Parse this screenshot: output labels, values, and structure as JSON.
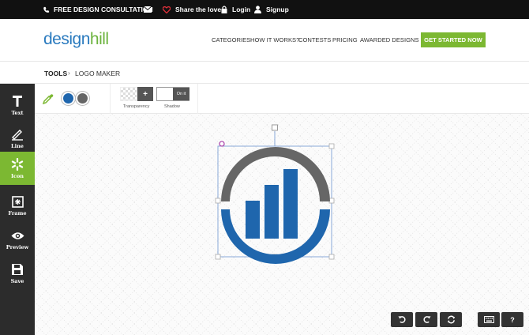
{
  "topbar": {
    "consultation": "FREE DESIGN CONSULTATION",
    "share": "Share the love",
    "login": "Login",
    "signup": "Signup"
  },
  "header": {
    "logo_part1": "design",
    "logo_part2": "hill",
    "nav": [
      "CATEGORIES",
      "HOW IT WORKS?",
      "CONTESTS",
      "PRICING",
      "AWARDED DESIGNS"
    ],
    "cta": "GET STARTED NOW"
  },
  "breadcrumb": {
    "tools": "TOOLS",
    "separator": "›",
    "current": "LOGO MAKER"
  },
  "sidebar": {
    "items": [
      {
        "label": "Text",
        "icon": "text-icon"
      },
      {
        "label": "Line",
        "icon": "line-icon"
      },
      {
        "label": "Icon",
        "icon": "asterisk-icon"
      },
      {
        "label": "Frame",
        "icon": "frame-icon"
      },
      {
        "label": "Preview",
        "icon": "eye-icon"
      },
      {
        "label": "Save",
        "icon": "floppy-icon"
      }
    ]
  },
  "toolbar": {
    "transparency_label": "Transparency",
    "shadow_label": "Shadow",
    "transparency_button": "+",
    "shadow_toggle": "On it",
    "colors": [
      "#1f66ad",
      "#666666"
    ]
  },
  "canvas_controls": {
    "undo": "undo-icon",
    "redo": "redo-icon",
    "refresh": "refresh-icon",
    "keyboard": "keyboard-icon",
    "help": "?"
  },
  "colors": {
    "accent_green": "#7cb832",
    "logo_blue": "#1f66ad",
    "logo_gray": "#666666",
    "dark": "#2c2c2c"
  }
}
